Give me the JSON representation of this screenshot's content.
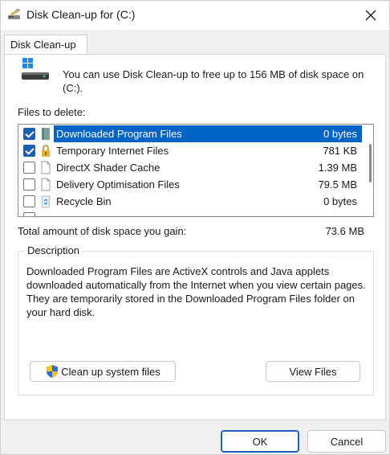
{
  "window": {
    "title": "Disk Clean-up for  (C:)"
  },
  "tabs": [
    {
      "label": "Disk Clean-up"
    }
  ],
  "info": {
    "text": "You can use Disk Clean-up to free up to 156 MB of disk space on (C:)."
  },
  "files": {
    "label": "Files to delete:",
    "items": [
      {
        "name": "Downloaded Program Files",
        "size": "0 bytes",
        "checked": true,
        "selected": true,
        "icon": "folder-icon"
      },
      {
        "name": "Temporary Internet Files",
        "size": "781 KB",
        "checked": true,
        "selected": false,
        "icon": "lock-icon"
      },
      {
        "name": "DirectX Shader Cache",
        "size": "1.39 MB",
        "checked": false,
        "selected": false,
        "icon": "file-icon"
      },
      {
        "name": "Delivery Optimisation Files",
        "size": "79.5 MB",
        "checked": false,
        "selected": false,
        "icon": "file-icon"
      },
      {
        "name": "Recycle Bin",
        "size": "0 bytes",
        "checked": false,
        "selected": false,
        "icon": "recycle-bin-icon"
      }
    ]
  },
  "total": {
    "label": "Total amount of disk space you gain:",
    "value": "73.6 MB"
  },
  "description": {
    "legend": "Description",
    "text": "Downloaded Program Files are ActiveX controls and Java applets downloaded automatically from the Internet when you view certain pages. They are temporarily stored in the Downloaded Program Files folder on your hard disk."
  },
  "buttons": {
    "cleanup": "Clean up system files",
    "view": "View Files",
    "ok": "OK",
    "cancel": "Cancel"
  },
  "colors": {
    "accent": "#0063c6",
    "checkbox": "#1a5fb4"
  }
}
